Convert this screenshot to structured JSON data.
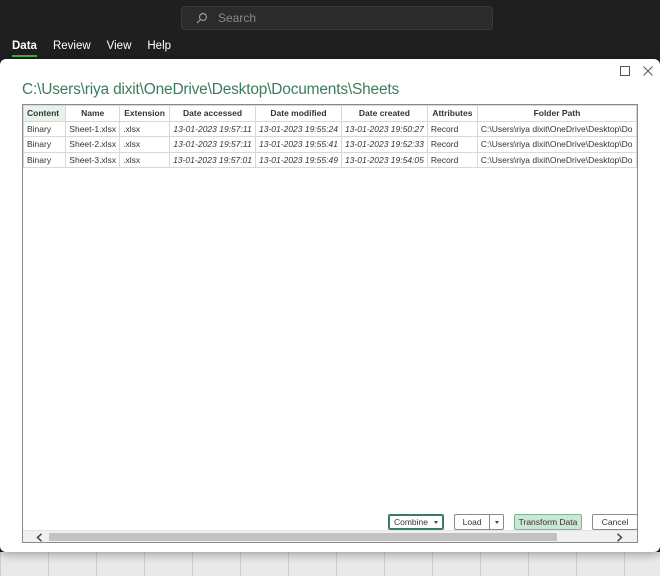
{
  "search": {
    "placeholder": "Search"
  },
  "ribbon": {
    "tabs": [
      {
        "label": "Data",
        "active": true
      },
      {
        "label": "Review",
        "active": false
      },
      {
        "label": "View",
        "active": false
      },
      {
        "label": "Help",
        "active": false
      }
    ]
  },
  "dialog": {
    "title": "C:\\Users\\riya dixit\\OneDrive\\Desktop\\Documents\\Sheets",
    "table": {
      "headers": [
        "Content",
        "Name",
        "Extension",
        "Date accessed",
        "Date modified",
        "Date created",
        "Attributes",
        "Folder Path"
      ],
      "rows": [
        [
          "Binary",
          "Sheet-1.xlsx",
          ".xlsx",
          "13-01-2023 19:57:11",
          "13-01-2023 19:55:24",
          "13-01-2023 19:50:27",
          "Record",
          "C:\\Users\\riya dixit\\OneDrive\\Desktop\\Do"
        ],
        [
          "Binary",
          "Sheet-2.xlsx",
          ".xlsx",
          "13-01-2023 19:57:11",
          "13-01-2023 19:55:41",
          "13-01-2023 19:52:33",
          "Record",
          "C:\\Users\\riya dixit\\OneDrive\\Desktop\\Do"
        ],
        [
          "Binary",
          "Sheet-3.xlsx",
          ".xlsx",
          "13-01-2023 19:57:01",
          "13-01-2023 19:55:49",
          "13-01-2023 19:54:05",
          "Record",
          "C:\\Users\\riya dixit\\OneDrive\\Desktop\\Do"
        ]
      ]
    },
    "buttons": {
      "combine": "Combine",
      "load": "Load",
      "transform": "Transform Data",
      "cancel": "Cancel"
    }
  },
  "colors": {
    "accent": "#3a7d5c",
    "primary_button_bg": "#cce8d4",
    "header_highlight": "#e6f2ea",
    "tab_underline": "#4caf50"
  }
}
